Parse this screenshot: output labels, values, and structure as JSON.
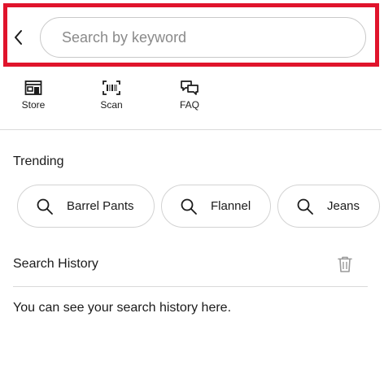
{
  "search": {
    "placeholder": "Search by keyword",
    "value": "",
    "highlight_color": "#e0142c"
  },
  "shortcuts": [
    {
      "label": "Store",
      "icon": "store-icon"
    },
    {
      "label": "Scan",
      "icon": "barcode-scan-icon"
    },
    {
      "label": "FAQ",
      "icon": "chat-bubbles-icon"
    }
  ],
  "trending": {
    "title": "Trending",
    "items": [
      {
        "label": "Barrel Pants",
        "icon": "search-icon"
      },
      {
        "label": "Flannel",
        "icon": "search-icon"
      },
      {
        "label": "Jeans",
        "icon": "search-icon"
      }
    ]
  },
  "history": {
    "title": "Search History",
    "empty_text": "You can see your search history here.",
    "clear_icon": "trash-icon"
  }
}
